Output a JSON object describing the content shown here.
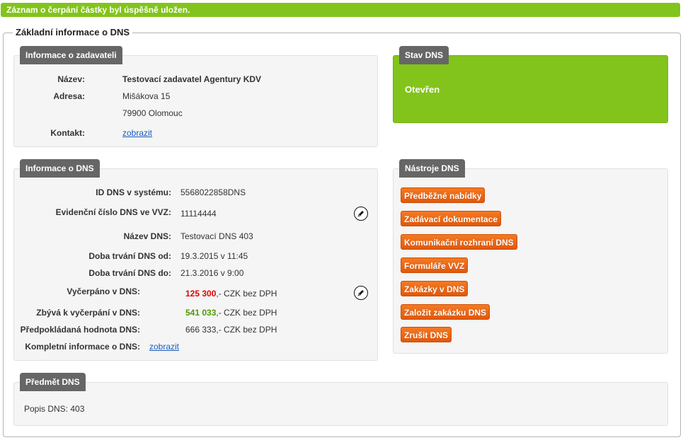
{
  "flash": {
    "message": "Záznam o čerpání částky byl úspěšně uložen."
  },
  "main": {
    "legend": "Základní informace o DNS"
  },
  "zadavatel": {
    "title": "Informace o zadavateli",
    "nazev_label": "Název:",
    "nazev_value": "Testovací zadavatel Agentury KDV",
    "adresa_label": "Adresa:",
    "adresa_line1": "Mišákova 15",
    "adresa_line2": "79900 Olomouc",
    "kontakt_label": "Kontakt:",
    "kontakt_link": "zobrazit"
  },
  "stav": {
    "title": "Stav DNS",
    "value": "Otevřen",
    "color": "#82c41b"
  },
  "dns_info": {
    "title": "Informace o DNS",
    "id_label": "ID DNS v systému:",
    "id_value": "5568022858DNS",
    "evid_label": "Evidenční číslo DNS ve VVZ:",
    "evid_value": "11114444",
    "nazev_label": "Název DNS:",
    "nazev_value": "Testovací DNS 403",
    "od_label": "Doba trvání DNS od:",
    "od_value": "19.3.2015 v 11:45",
    "do_label": "Doba trvání DNS do:",
    "do_value": "21.3.2016 v 9:00",
    "vycerpano_label": "Vyčerpáno v DNS:",
    "vycerpano_amount": "125 300",
    "vycerpano_suffix": ",- CZK bez DPH",
    "zbyva_label": "Zbývá k vyčerpání v DNS:",
    "zbyva_amount": "541 033",
    "zbyva_suffix": ",- CZK bez DPH",
    "predpokl_label": "Předpokládaná hodnota DNS:",
    "predpokl_value": "666 333,- CZK bez DPH",
    "kompletni_label": "Kompletní informace o DNS:",
    "kompletni_link": "zobrazit"
  },
  "nastroje": {
    "title": "Nástroje DNS",
    "buttons": [
      "Předběžné nabídky",
      "Zadávací dokumentace",
      "Komunikační rozhraní DNS",
      "Formuláře VVZ",
      "Zakázky v DNS",
      "Založit zakázku DNS",
      "Zrušit DNS"
    ],
    "button_color": "#ee6a14"
  },
  "predmet": {
    "title": "Předmět DNS",
    "popis": "Popis DNS: 403"
  }
}
